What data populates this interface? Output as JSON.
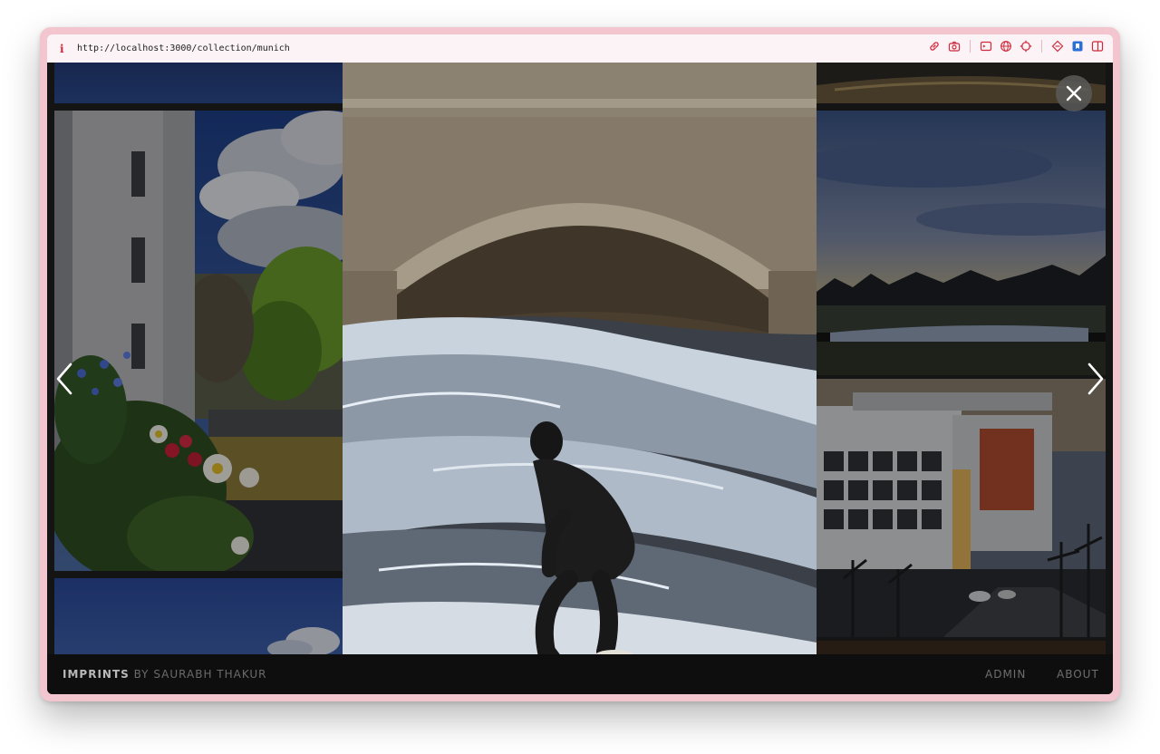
{
  "browser": {
    "info_icon": "info-icon",
    "url": "http://localhost:3000/collection/munich",
    "toolbar_icons": [
      "link-icon",
      "camera-icon",
      "terminal-icon",
      "globe-icon",
      "crosshair-icon",
      "extension-icon",
      "bookmark-icon",
      "sidebar-icon"
    ]
  },
  "gallery": {
    "brand_name": "IMPRINTS",
    "brand_by": "BY SAURABH THAKUR",
    "nav": {
      "admin": "ADMIN",
      "about": "ABOUT"
    },
    "controls": {
      "close_icon": "close-icon",
      "prev_icon": "chevron-left-icon",
      "next_icon": "chevron-right-icon"
    },
    "photos": [
      {
        "name": "blue-sky",
        "subject": "blue sky"
      },
      {
        "name": "balcony-flowers",
        "subject": "flowers on balcony with building and clouds"
      },
      {
        "name": "blue-sky-cloud",
        "subject": "blue sky with cloud"
      },
      {
        "name": "eisbach-surfer",
        "subject": "surfer on river wave under stone bridge"
      },
      {
        "name": "river-dusk",
        "subject": "river at dusk"
      },
      {
        "name": "lake-park",
        "subject": "lake and park under cloudy sky"
      },
      {
        "name": "office-buildings",
        "subject": "office buildings at dusk with street"
      }
    ]
  },
  "colors": {
    "window_frame": "#f3c6cf",
    "urlbar": "#fbf3f5",
    "accent": "#d02a3c",
    "viewport": "#141414"
  }
}
